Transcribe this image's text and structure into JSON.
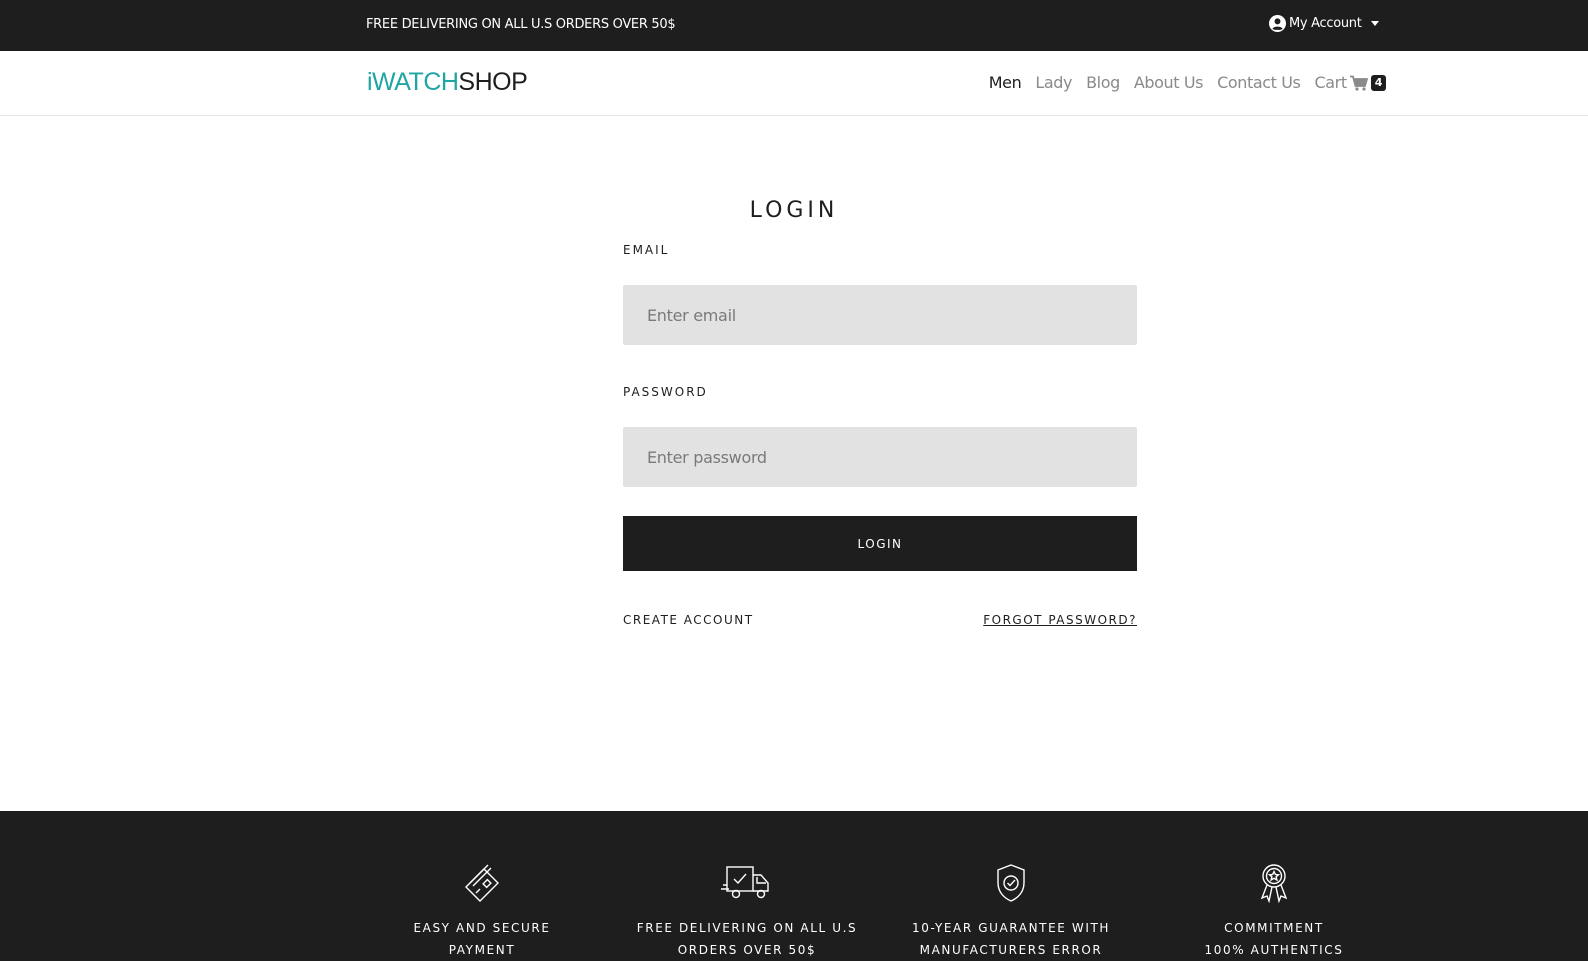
{
  "topbar": {
    "promo": "FREE DELIVERING ON ALL U.S ORDERS OVER 50$",
    "account_label": "My Account"
  },
  "brand": {
    "logo_part1": "iWATCH",
    "logo_part2": "SHOP"
  },
  "nav": {
    "items": [
      {
        "label": "Men",
        "active": true
      },
      {
        "label": "Lady"
      },
      {
        "label": "Blog"
      },
      {
        "label": "About Us"
      },
      {
        "label": "Contact Us"
      }
    ],
    "cart_label": "Cart",
    "cart_count": "4"
  },
  "login": {
    "title": "LOGIN",
    "email_label": "EMAIL",
    "email_placeholder": "Enter email",
    "email_value": "",
    "password_label": "PASSWORD",
    "password_placeholder": "Enter password",
    "password_value": "",
    "submit_label": "LOGIN",
    "create_account": "CREATE ACCOUNT",
    "forgot_password": "FORGOT PASSWORD?"
  },
  "features": [
    {
      "icon": "credit-card-icon",
      "line1": "EASY AND SECURE",
      "line2": "PAYMENT"
    },
    {
      "icon": "delivery-truck-icon",
      "line1": "FREE DELIVERING ON ALL U.S",
      "line2": "ORDERS OVER 50$"
    },
    {
      "icon": "shield-check-icon",
      "line1": "10-YEAR GUARANTEE WITH",
      "line2": "MANUFACTURERS ERROR"
    },
    {
      "icon": "award-ribbon-icon",
      "line1": "COMMITMENT",
      "line2": "100% AUTHENTICS"
    }
  ],
  "colors": {
    "dark": "#1e1e1e",
    "accent": "#20a5a5",
    "field_bg": "#e2e2e2",
    "nav_inactive": "#8a8a8a"
  }
}
